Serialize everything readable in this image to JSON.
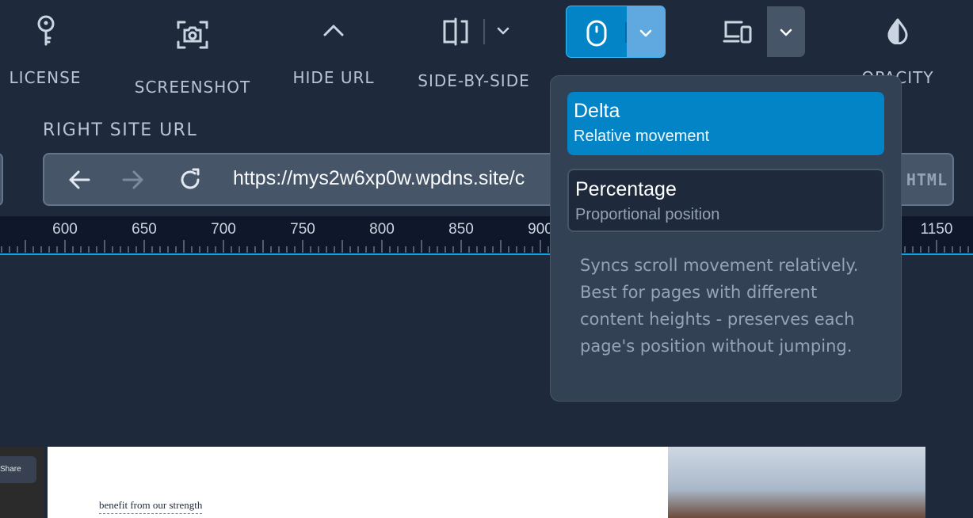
{
  "toolbar": {
    "license_label": "LICENSE",
    "screenshot_label": "SCREENSHOT",
    "hide_url_label": "HIDE URL",
    "side_by_side_label": "SIDE-BY-SIDE",
    "opacity_label": "OPACITY"
  },
  "url_section": {
    "label": "RIGHT SITE URL",
    "url": "https://mys2w6xp0w.wpdns.site/c",
    "html_tag": "HTML"
  },
  "ruler": {
    "ticks": [
      "600",
      "650",
      "700",
      "750",
      "800",
      "850",
      "900",
      "1150"
    ]
  },
  "scroll_sync_dropdown": {
    "options": [
      {
        "title": "Delta",
        "subtitle": "Relative movement",
        "selected": true
      },
      {
        "title": "Percentage",
        "subtitle": "Proportional position",
        "selected": false
      }
    ],
    "description": "Syncs scroll movement relatively. Best for pages with different content heights - preserves each page's position without jumping."
  },
  "preview": {
    "share_label": "Share",
    "benefit_text": "benefit from our strength"
  },
  "colors": {
    "background": "#1e293b",
    "accent": "#0284c7",
    "ruler_line": "#0ea5e9"
  }
}
